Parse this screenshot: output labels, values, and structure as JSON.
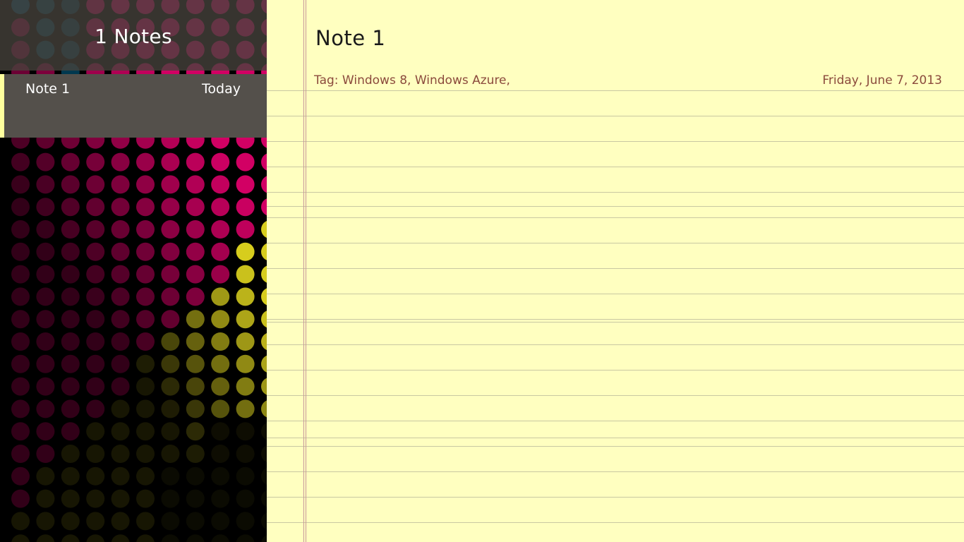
{
  "sidebar": {
    "notes_count_label": "1 Notes",
    "notes": [
      {
        "title": "Note 1",
        "date": "Today",
        "selected": true
      }
    ]
  },
  "note": {
    "title": "Note 1",
    "tags_label": "Tag: Windows 8, Windows Azure,",
    "date": "Friday, June 7, 2013",
    "body": ""
  },
  "colors": {
    "paper": "#ffffc0",
    "rule_line": "#c9c8a2",
    "margin_line": "#c7969a",
    "meta_text": "#8b4a3c",
    "selected_accent": "#ffff9e",
    "list_item_bg": "#54504b",
    "dot_blue": "#005f86",
    "dot_magenta": "#e4006d",
    "dot_yellow": "#e2d81f"
  }
}
